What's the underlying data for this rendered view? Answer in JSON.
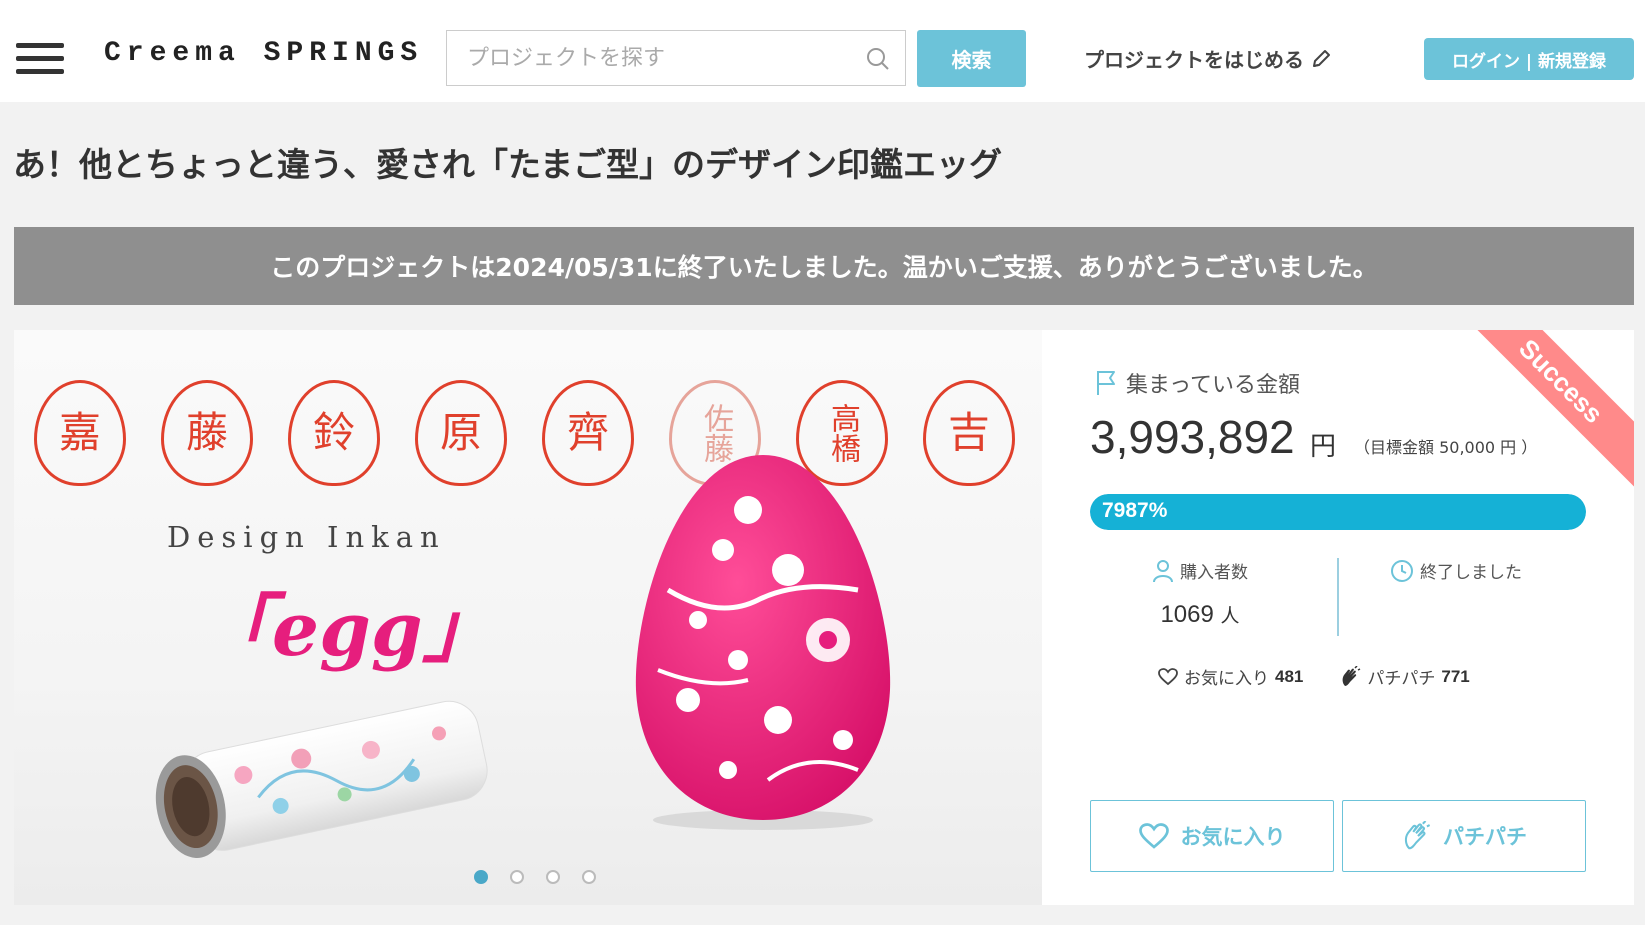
{
  "header": {
    "logo": "Creema SPRINGS",
    "search_placeholder": "プロジェクトを探す",
    "search_button": "検索",
    "start_project": "プロジェクトをはじめる",
    "login_signup": "ログイン | 新規登録"
  },
  "project": {
    "title": "あ！他とちょっと違う、愛され「たまご型」のデザイン印鑑エッグ",
    "ended_message": "このプロジェクトは2024/05/31に終了いたしました。温かいご支援、ありがとうございました。"
  },
  "hero": {
    "seals": [
      "嘉",
      "藤",
      "鈴",
      "原",
      "齊",
      "佐藤",
      "高橋",
      "吉"
    ],
    "design_text": "Design Inkan",
    "egg_text": "「egg」",
    "slides": 4,
    "active_slide": 1
  },
  "funding": {
    "ribbon": "Success",
    "raised_label": "集まっている金額",
    "amount": "3,993,892",
    "amount_unit": "円",
    "goal_text": "（目標金額 50,000 円 ）",
    "percent_text": "7987%",
    "progress_fraction": 1.0,
    "buyers_label": "購入者数",
    "buyers_count": "1069",
    "buyers_unit": "人",
    "status": "終了しました",
    "favorites_label": "お気に入り",
    "favorites_count": "481",
    "clap_label": "パチパチ",
    "clap_count": "771"
  },
  "actions": {
    "favorite_button": "お気に入り",
    "clap_button": "パチパチ"
  },
  "colors": {
    "accent": "#6cc3d9",
    "progress": "#15b1d6",
    "banner": "#8f8f8f",
    "ribbon": "#ff8a8a",
    "seal_red": "#e0402c",
    "egg_pink": "#e61e7d"
  }
}
